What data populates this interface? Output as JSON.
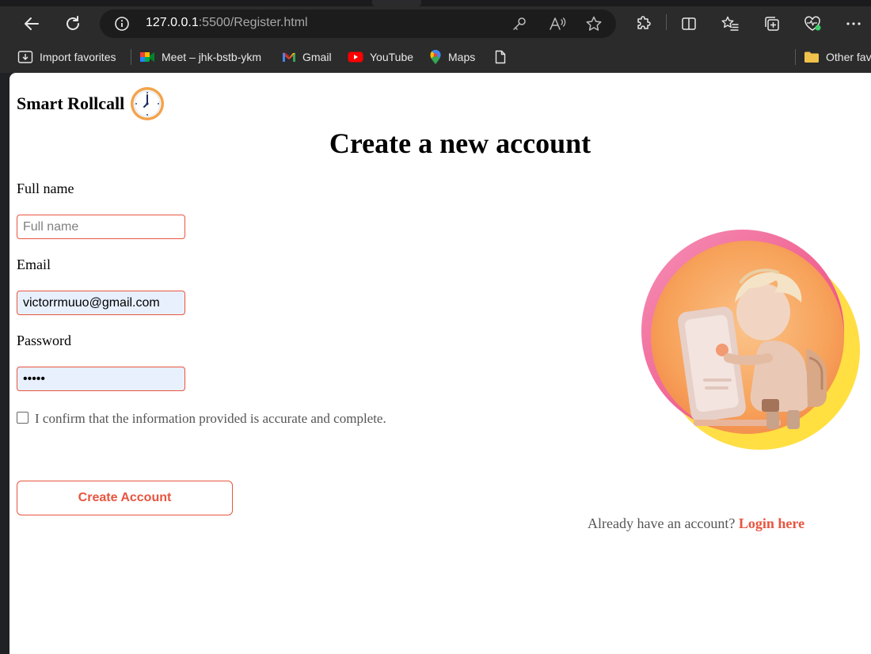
{
  "browser": {
    "address": {
      "host": "127.0.0.1",
      "rest": ":5500/Register.html"
    },
    "bookmarks": [
      {
        "label": "Import favorites",
        "icon": "import-icon"
      },
      {
        "label": "Meet – jhk-bstb-ykm",
        "icon": "meet-icon"
      },
      {
        "label": "Gmail",
        "icon": "gmail-icon"
      },
      {
        "label": "YouTube",
        "icon": "youtube-icon"
      },
      {
        "label": "Maps",
        "icon": "maps-icon"
      },
      {
        "label": "",
        "icon": "page-icon"
      }
    ],
    "other_favorites": "Other fav"
  },
  "page": {
    "brand": "Smart Rollcall",
    "heading": "Create a new account",
    "form": {
      "full_name_label": "Full name",
      "full_name_placeholder": "Full name",
      "email_label": "Email",
      "email_value": "victorrmuuo@gmail.com",
      "password_label": "Password",
      "password_value": "•••••",
      "confirm_text": "I confirm that the information provided is accurate and complete.",
      "submit_label": "Create Account"
    },
    "login_prompt": "Already have an account?",
    "login_link": "Login here"
  },
  "colors": {
    "accent": "#e8553f",
    "chrome": "#2b2b2b",
    "autofill": "#e8f0fe"
  }
}
